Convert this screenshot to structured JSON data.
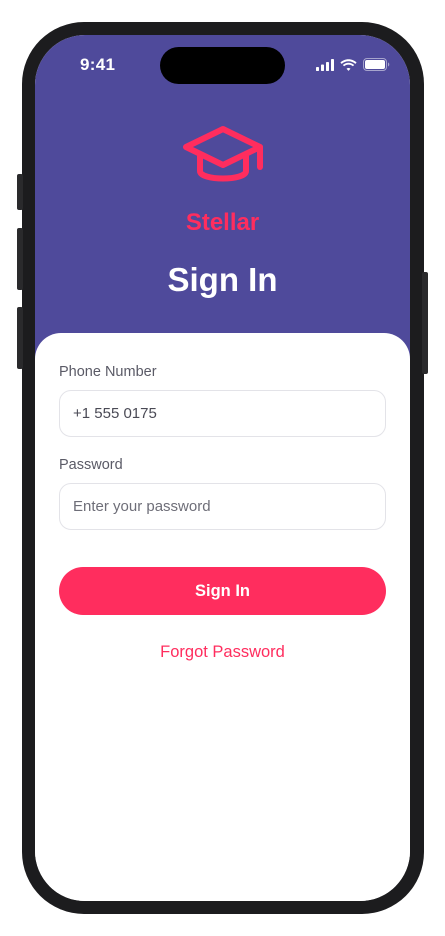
{
  "status_bar": {
    "time": "9:41",
    "icons": [
      "signal-icon",
      "wifi-icon",
      "battery-icon"
    ]
  },
  "brand": {
    "logo_icon": "graduation-cap-icon",
    "name": "Stellar"
  },
  "page": {
    "title": "Sign In"
  },
  "form": {
    "phone": {
      "label": "Phone Number",
      "value": "+1 555 0175"
    },
    "password": {
      "label": "Password",
      "placeholder": "Enter your password",
      "value": ""
    },
    "submit_label": "Sign In",
    "forgot_label": "Forgot Password"
  },
  "colors": {
    "header_background": "#4f4a9b",
    "accent": "#ff2d5e",
    "card_background": "#ffffff",
    "device_frame": "#1c1c1e"
  }
}
